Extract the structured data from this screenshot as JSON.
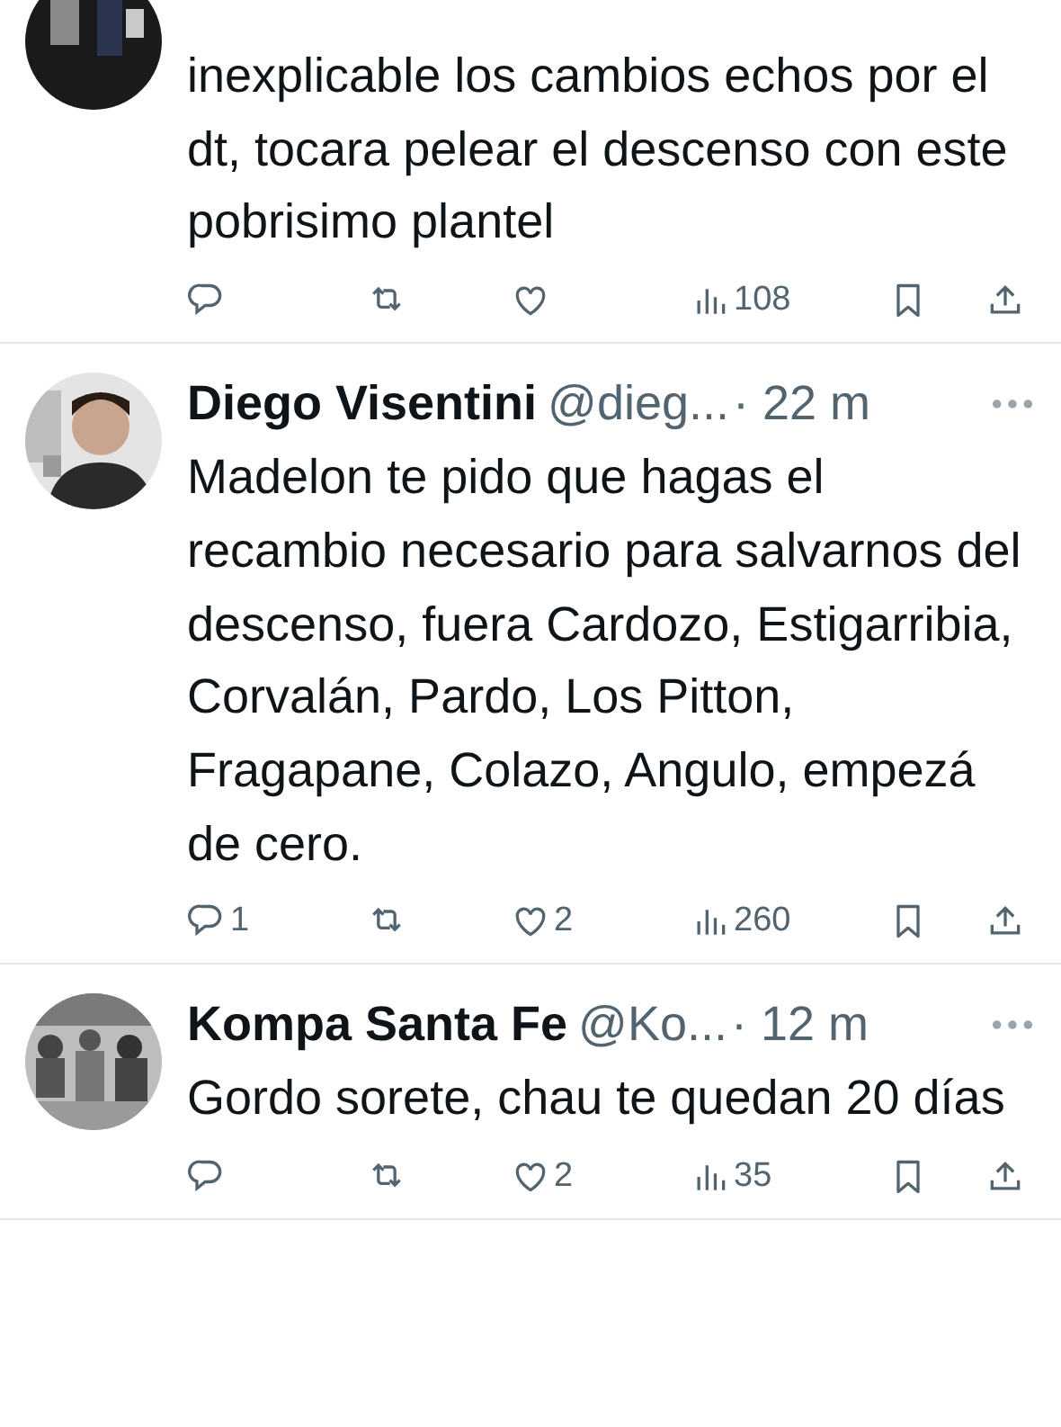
{
  "tweets": [
    {
      "text": "inexplicable los cambios echos por el dt, tocara pelear el descenso con este pobrisimo plantel",
      "stats": {
        "views": "108"
      }
    },
    {
      "name": "Diego Visentini",
      "handle": "@dieg...",
      "time": "· 22 m",
      "text": "Madelon te pido que hagas el recambio necesario para salvarnos del descenso, fuera Cardozo, Estigarribia, Corvalán, Pardo, Los Pitton, Fragapane, Colazo, Angulo, empezá de cero.",
      "stats": {
        "replies": "1",
        "likes": "2",
        "views": "260"
      }
    },
    {
      "name": "Kompa Santa Fe",
      "handle": "@Ko...",
      "time": "· 12 m",
      "text": "Gordo sorete, chau te quedan 20 días",
      "stats": {
        "likes": "2",
        "views": "35"
      }
    }
  ]
}
